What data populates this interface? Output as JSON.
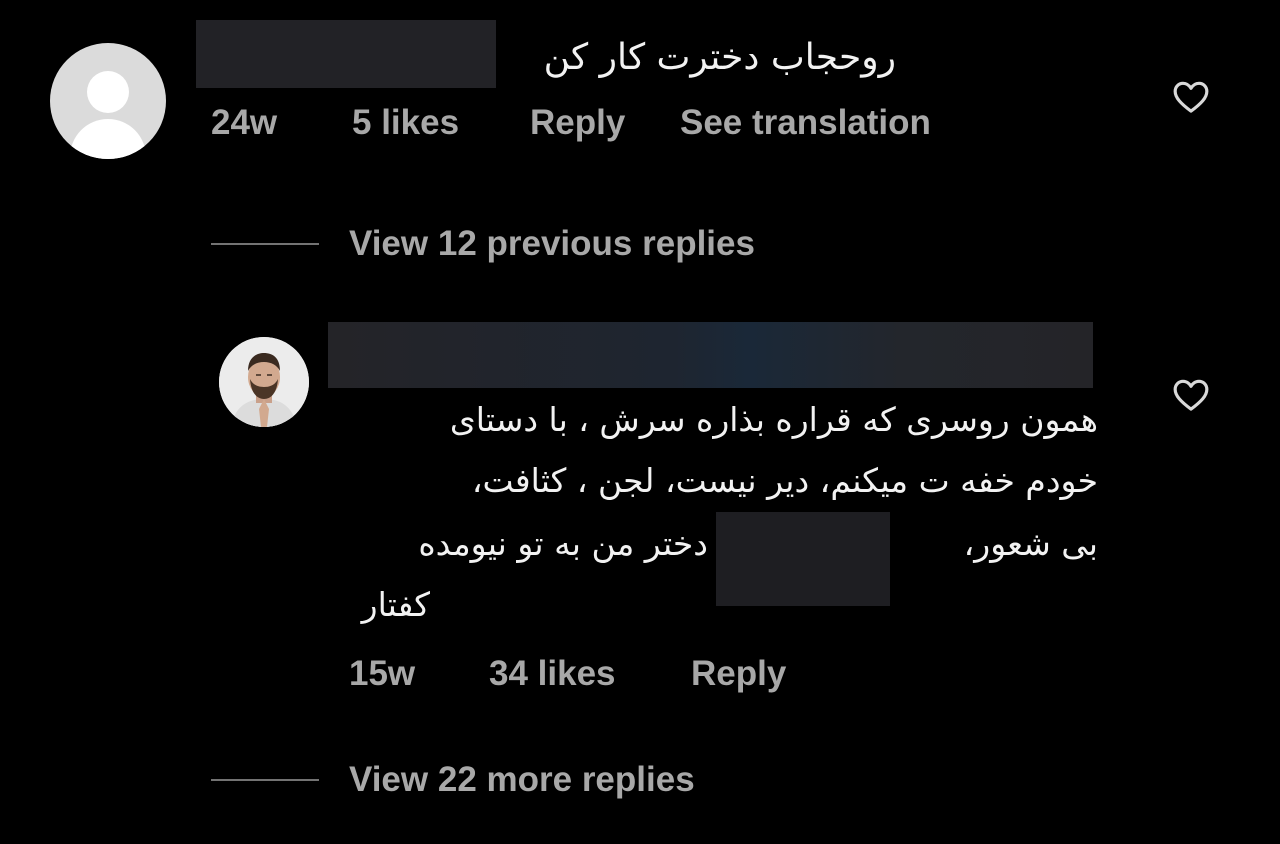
{
  "comments": [
    {
      "text": "روحجاب دخترت کار کن",
      "time": "24w",
      "likes": "5 likes",
      "reply_label": "Reply",
      "translation_label": "See translation"
    }
  ],
  "thread": {
    "view_previous_label": "View 12 previous replies",
    "reply": {
      "lines": [
        "همون روسری که قراره بذاره سرش ، با دستای",
        "خودم خفه ت میکنم، دیر نیست، لجن ، کثافت،",
        "بی شعور،",
        "دختر من به تو نیومده",
        "کفتار"
      ],
      "time": "15w",
      "likes": "34 likes",
      "reply_label": "Reply"
    },
    "view_more_label": "View 22 more replies"
  },
  "icons": {
    "like": "heart-outline-icon",
    "default_avatar": "default-avatar-icon"
  },
  "colors": {
    "background": "#000000",
    "primary_text": "#f2f2f2",
    "secondary_text": "#a8a8a8",
    "divider": "#737373"
  }
}
